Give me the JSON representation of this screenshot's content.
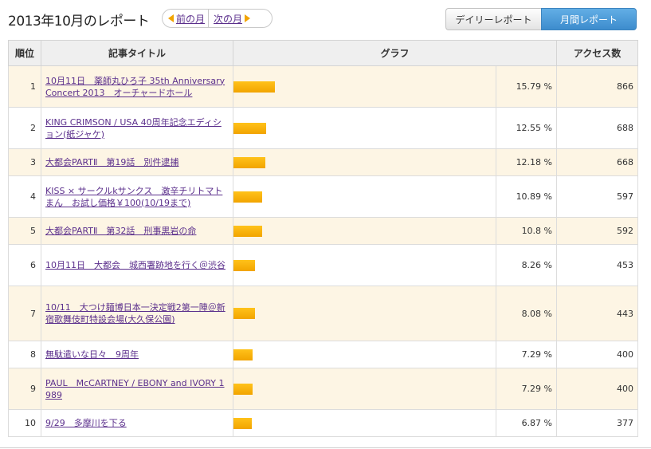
{
  "header": {
    "title": "2013年10月のレポート",
    "prev_label": "前の月",
    "next_label": "次の月"
  },
  "tabs": [
    {
      "label": "デイリーレポート",
      "active": false
    },
    {
      "label": "月間レポート",
      "active": true
    }
  ],
  "table": {
    "headers": {
      "rank": "順位",
      "title": "記事タイトル",
      "graph": "グラフ",
      "access": "アクセス数"
    },
    "rows": [
      {
        "rank": "1",
        "title": "10月11日　薬師丸ひろ子 35th Anniversary Concert 2013　オーチャードホール",
        "percent": "15.79 %",
        "share": 15.79,
        "count": "866"
      },
      {
        "rank": "2",
        "title": "KING CRIMSON / USA 40周年記念エディション(紙ジャケ)",
        "percent": "12.55 %",
        "share": 12.55,
        "count": "688"
      },
      {
        "rank": "3",
        "title": "大都会PARTⅡ　第19話　別件逮捕",
        "percent": "12.18 %",
        "share": 12.18,
        "count": "668"
      },
      {
        "rank": "4",
        "title": "KISS × サークルkサンクス　激辛チリトマトまん　お試し価格￥100(10/19まで)",
        "percent": "10.89 %",
        "share": 10.89,
        "count": "597"
      },
      {
        "rank": "5",
        "title": "大都会PARTⅡ　第32話　刑事黒岩の命",
        "percent": "10.8 %",
        "share": 10.8,
        "count": "592"
      },
      {
        "rank": "6",
        "title": "10月11日　大都会　城西署跡地を行く＠渋谷",
        "percent": "8.26 %",
        "share": 8.26,
        "count": "453"
      },
      {
        "rank": "7",
        "title": "10/11　大つけ麺博日本一決定戦2第一陣＠新宿歌舞伎町特設会場(大久保公園)",
        "percent": "8.08 %",
        "share": 8.08,
        "count": "443"
      },
      {
        "rank": "8",
        "title": "無駄遣いな日々　9周年",
        "percent": "7.29 %",
        "share": 7.29,
        "count": "400"
      },
      {
        "rank": "9",
        "title": "PAUL　McCARTNEY / EBONY and IVORY 1989",
        "percent": "7.29 %",
        "share": 7.29,
        "count": "400"
      },
      {
        "rank": "10",
        "title": "9/29　多摩川を下る",
        "percent": "6.87 %",
        "share": 6.87,
        "count": "377"
      }
    ]
  },
  "colors": {
    "bar": "#f2a400",
    "link": "#5b2f8c",
    "active_tab": "#3d8ccd",
    "odd_row": "#fdf5e4"
  }
}
